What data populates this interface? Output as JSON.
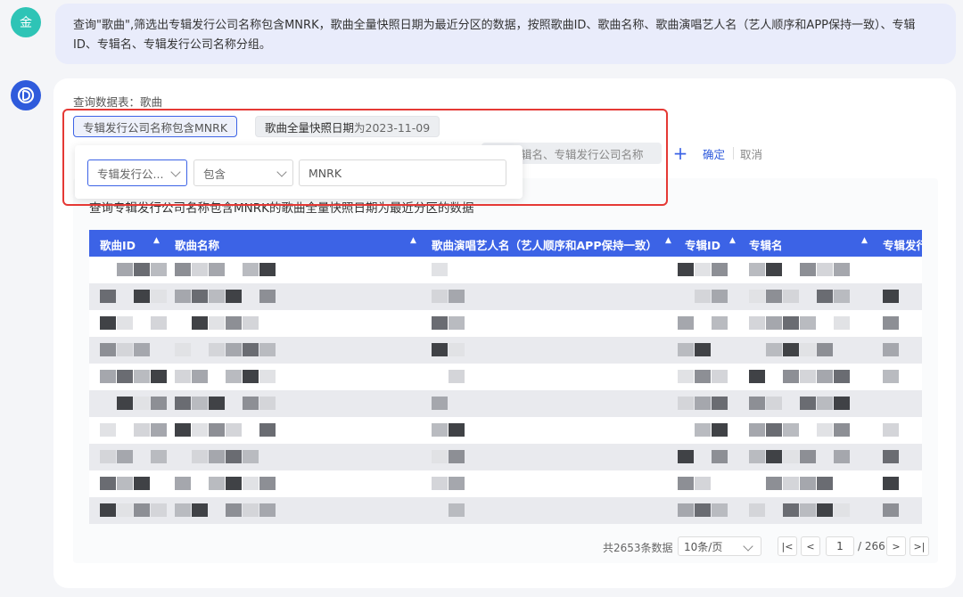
{
  "user": {
    "avatar_text": "金",
    "message": "查询\"歌曲\",筛选出专辑发行公司名称包含MNRK，歌曲全量快照日期为最近分区的数据，按照歌曲ID、歌曲名称、歌曲演唱艺人名（艺人顺序和APP保持一致）、专辑ID、专辑名、专辑发行公司名称分组。"
  },
  "bot": {
    "avatar_icon": "bot-logo-icon",
    "table_label": "查询数据表：歌曲",
    "filters": {
      "chip1": "专辑发行公司名称包含MNRK",
      "chip2_prefix": "歌曲全量快照日期",
      "chip2_suffix": "为2023-11-09",
      "background_chip": "辑名、专辑发行公司名称",
      "add_icon": "plus-icon",
      "confirm": "确定",
      "cancel": "取消"
    },
    "popover": {
      "field": "专辑发行公...",
      "operator": "包含",
      "value": "MNRK"
    },
    "result_title": "查询专辑发行公司名称包含MNRK的歌曲全量快照日期为最近分区的数据",
    "columns": [
      "歌曲ID",
      "歌曲名称",
      "歌曲演唱艺人名（艺人顺序和APP保持一致）",
      "专辑ID",
      "专辑名",
      "专辑发行"
    ],
    "pagination": {
      "total": "共2653条数据",
      "page_size": "10条/页",
      "current": "1",
      "total_pages": "/ 266"
    },
    "colors": {
      "accent": "#3c63e6",
      "highlight_box": "#e53935"
    }
  }
}
